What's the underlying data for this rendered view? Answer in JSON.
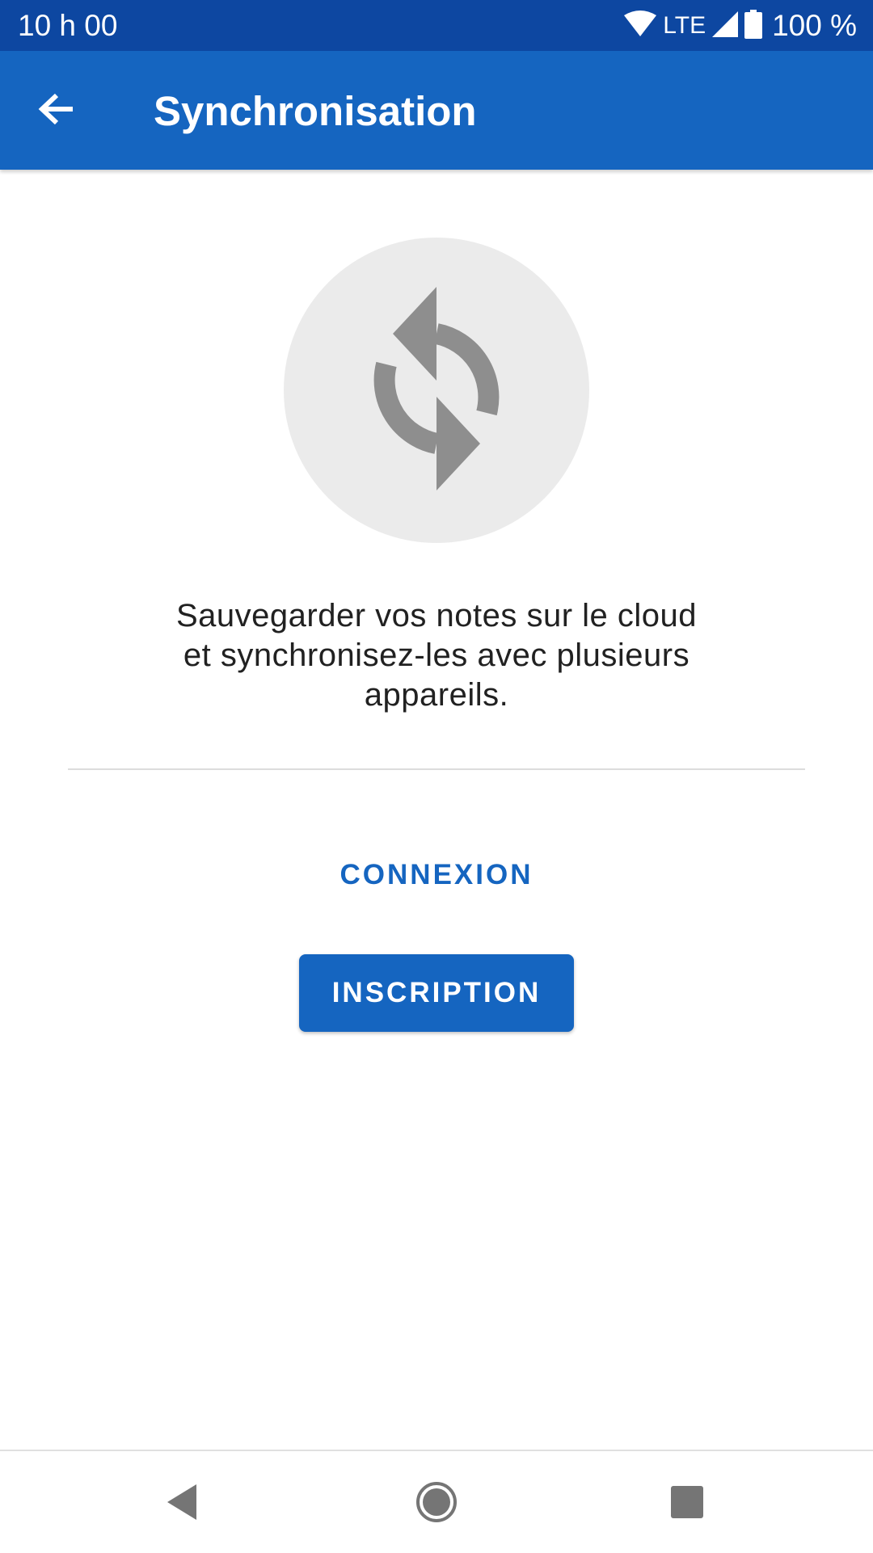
{
  "status_bar": {
    "time": "10 h 00",
    "network": "LTE",
    "battery": "100 %",
    "icons": [
      "wifi-icon",
      "signal-icon",
      "battery-icon"
    ]
  },
  "app_bar": {
    "title": "Synchronisation",
    "back_icon": "arrow-back-icon"
  },
  "content": {
    "illustration_icon": "sync-icon",
    "description_lines": [
      "Sauvegarder vos notes sur le cloud",
      "et synchronisez-les avec plusieurs",
      "appareils."
    ],
    "login_label": "CONNEXION",
    "signup_label": "INSCRIPTION"
  },
  "nav_bar": {
    "icons": [
      "nav-back-icon",
      "nav-home-icon",
      "nav-recents-icon"
    ]
  },
  "colors": {
    "status_bar": "#0d47a1",
    "primary": "#1565c0",
    "icon_gray": "#8e8e8e",
    "circle_bg": "#ebebeb",
    "text": "#212121"
  }
}
